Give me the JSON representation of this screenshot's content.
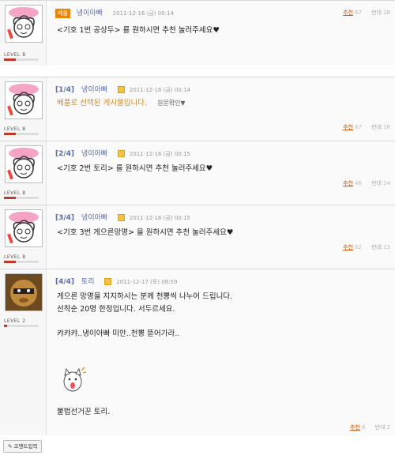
{
  "posts": [
    {
      "badge": "베플",
      "nick": "냉이아빠",
      "date": "2011-12-16 (금) 00:14",
      "level": "LEVEL 8",
      "lines": [
        "<기호 1번 공상두> 를 원하시면 추천 눌러주세요♥"
      ],
      "up_label": "추천",
      "up": "67",
      "down_label": "반대",
      "down": "28"
    },
    {
      "tag": "[1/4]",
      "nick": "냉이아빠",
      "date": "2011-12-16 (금) 00:14",
      "level": "LEVEL 8",
      "lines": [
        "베플로 선택된 게시물입니다."
      ],
      "extra": "원문확인▼",
      "up_label": "추천",
      "up": "67",
      "down_label": "반대",
      "down": "28"
    },
    {
      "tag": "[2/4]",
      "nick": "냉이아빠",
      "date": "2011-12-16 (금) 00:15",
      "level": "LEVEL 8",
      "lines": [
        "<기호 2번 토리> 를 원하시면 추천 눌러주세요♥"
      ],
      "up_label": "추천",
      "up": "46",
      "down_label": "반대",
      "down": "24"
    },
    {
      "tag": "[3/4]",
      "nick": "냉이아빠",
      "date": "2011-12-16 (금) 00:15",
      "level": "LEVEL 8",
      "lines": [
        "<기호 3번 게으른망명> 을 원하시면 추천 눌러주세요♥"
      ],
      "up_label": "추천",
      "up": "62",
      "down_label": "반대",
      "down": "23"
    },
    {
      "tag": "[4/4]",
      "nick": "토리",
      "date": "2011-12-17 (토) 08:59",
      "level": "LEVEL 2",
      "lines": [
        "게으른 망명을 지지하시는 분께 천뽕씩 나누어 드립니다.",
        "선착순 20명 한정입니다. 서두르세요.",
        "",
        "캬캬캬..냉이아빠 미안..천뽕 뜯어가라..",
        "",
        "",
        "",
        "",
        "",
        "불법선거꾼 토리."
      ],
      "up_label": "추천",
      "up": "6",
      "down_label": "반대",
      "down": "2"
    }
  ],
  "comment_button": "코멘트입력",
  "colors": {
    "accent": "#d98a1c",
    "nick": "#5a6fa8",
    "badge": "#e8860c"
  }
}
